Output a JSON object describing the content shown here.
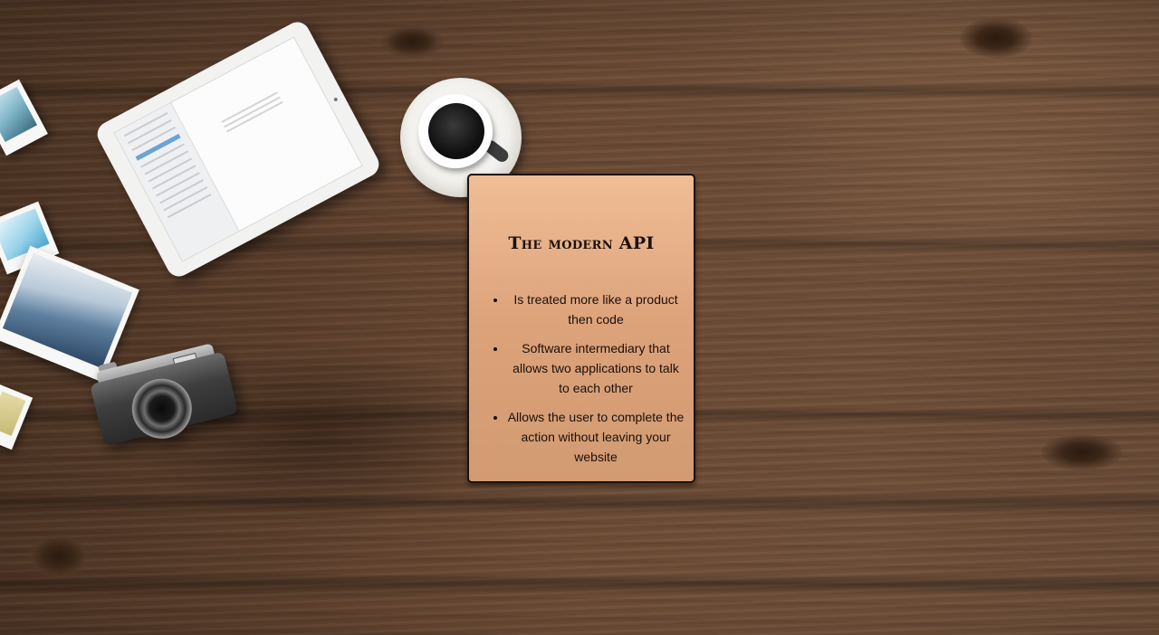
{
  "card": {
    "title": "The modern API",
    "bullets": [
      "Is treated more like a product then code",
      "Software intermediary that allows two applications to talk to each other",
      "Allows the user to complete the action without leaving your website"
    ]
  },
  "colors": {
    "card_top": "#f0bd95",
    "card_bottom": "#d29b72",
    "card_border": "#1e120a",
    "wood_base": "#5b3e2b"
  },
  "decor": {
    "icons": [
      "tablet-icon",
      "coffee-cup-icon",
      "camera-icon",
      "photo-icon"
    ]
  }
}
